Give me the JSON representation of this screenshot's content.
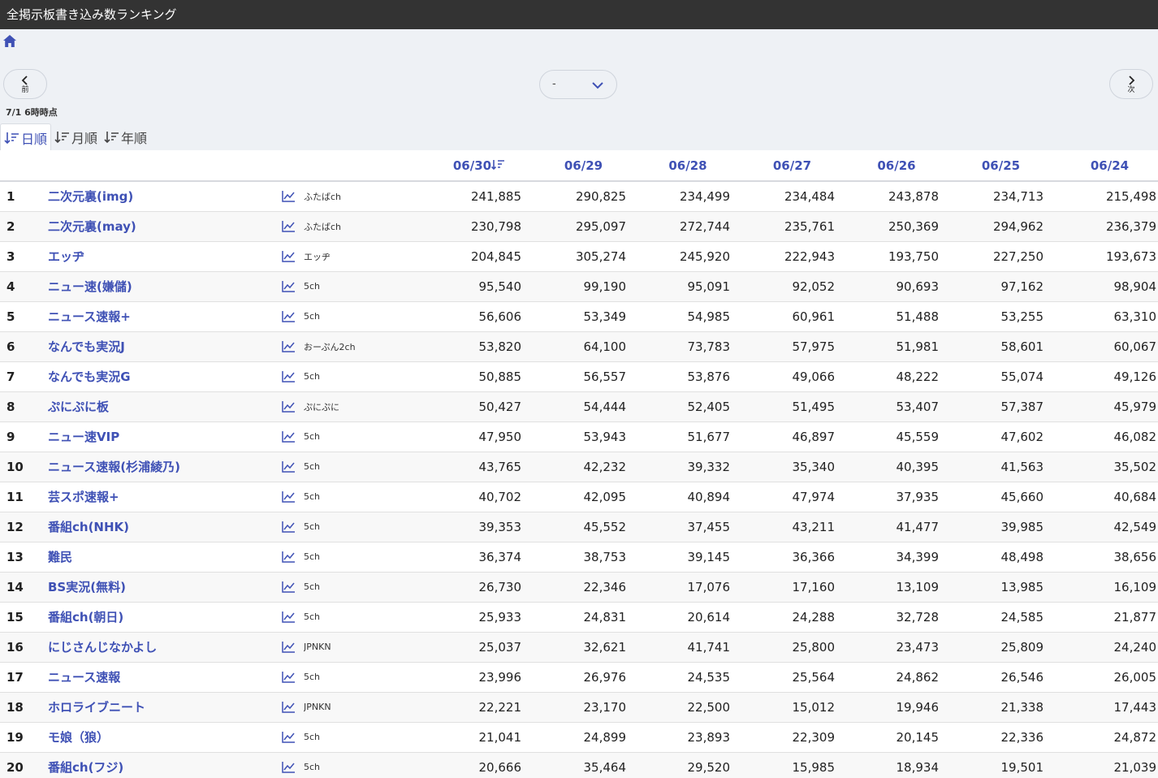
{
  "app": {
    "title": "全掲示板書き込み数ランキング"
  },
  "nav": {
    "prev_label": "前",
    "next_label": "次",
    "select_value": "-",
    "timestamp": "7/1 6時時点"
  },
  "tabs": [
    {
      "label": "日順",
      "active": true
    },
    {
      "label": "月順",
      "active": false
    },
    {
      "label": "年順",
      "active": false
    }
  ],
  "columns": [
    "06/30",
    "06/29",
    "06/28",
    "06/27",
    "06/26",
    "06/25",
    "06/24"
  ],
  "rows": [
    {
      "rank": "1",
      "name": "二次元裏(img)",
      "source": "ふたばch",
      "values": [
        "241,885",
        "290,825",
        "234,499",
        "234,484",
        "243,878",
        "234,713",
        "215,498"
      ]
    },
    {
      "rank": "2",
      "name": "二次元裏(may)",
      "source": "ふたばch",
      "values": [
        "230,798",
        "295,097",
        "272,744",
        "235,761",
        "250,369",
        "294,962",
        "236,379"
      ]
    },
    {
      "rank": "3",
      "name": "エッヂ",
      "source": "エッヂ",
      "values": [
        "204,845",
        "305,274",
        "245,920",
        "222,943",
        "193,750",
        "227,250",
        "193,673"
      ]
    },
    {
      "rank": "4",
      "name": "ニュー速(嫌儲)",
      "source": "5ch",
      "values": [
        "95,540",
        "99,190",
        "95,091",
        "92,052",
        "90,693",
        "97,162",
        "98,904"
      ]
    },
    {
      "rank": "5",
      "name": "ニュース速報+",
      "source": "5ch",
      "values": [
        "56,606",
        "53,349",
        "54,985",
        "60,961",
        "51,488",
        "53,255",
        "63,310"
      ]
    },
    {
      "rank": "6",
      "name": "なんでも実況J",
      "source": "おーぷん2ch",
      "values": [
        "53,820",
        "64,100",
        "73,783",
        "57,975",
        "51,981",
        "58,601",
        "60,067"
      ]
    },
    {
      "rank": "7",
      "name": "なんでも実況G",
      "source": "5ch",
      "values": [
        "50,885",
        "56,557",
        "53,876",
        "49,066",
        "48,222",
        "55,074",
        "49,126"
      ]
    },
    {
      "rank": "8",
      "name": "ぷにぷに板",
      "source": "ぷにぷに",
      "values": [
        "50,427",
        "54,444",
        "52,405",
        "51,495",
        "53,407",
        "57,387",
        "45,979"
      ]
    },
    {
      "rank": "9",
      "name": "ニュー速VIP",
      "source": "5ch",
      "values": [
        "47,950",
        "53,943",
        "51,677",
        "46,897",
        "45,559",
        "47,602",
        "46,082"
      ]
    },
    {
      "rank": "10",
      "name": "ニュース速報(杉浦綾乃)",
      "source": "5ch",
      "values": [
        "43,765",
        "42,232",
        "39,332",
        "35,340",
        "40,395",
        "41,563",
        "35,502"
      ]
    },
    {
      "rank": "11",
      "name": "芸スポ速報+",
      "source": "5ch",
      "values": [
        "40,702",
        "42,095",
        "40,894",
        "47,974",
        "37,935",
        "45,660",
        "40,684"
      ]
    },
    {
      "rank": "12",
      "name": "番組ch(NHK)",
      "source": "5ch",
      "values": [
        "39,353",
        "45,552",
        "37,455",
        "43,211",
        "41,477",
        "39,985",
        "42,549"
      ]
    },
    {
      "rank": "13",
      "name": "難民",
      "source": "5ch",
      "values": [
        "36,374",
        "38,753",
        "39,145",
        "36,366",
        "34,399",
        "48,498",
        "38,656"
      ]
    },
    {
      "rank": "14",
      "name": "BS実況(無料)",
      "source": "5ch",
      "values": [
        "26,730",
        "22,346",
        "17,076",
        "17,160",
        "13,109",
        "13,985",
        "16,109"
      ]
    },
    {
      "rank": "15",
      "name": "番組ch(朝日)",
      "source": "5ch",
      "values": [
        "25,933",
        "24,831",
        "20,614",
        "24,288",
        "32,728",
        "24,585",
        "21,877"
      ]
    },
    {
      "rank": "16",
      "name": "にじさんじなかよし",
      "source": "JPNKN",
      "values": [
        "25,037",
        "32,621",
        "41,741",
        "25,800",
        "23,473",
        "25,809",
        "24,240"
      ]
    },
    {
      "rank": "17",
      "name": "ニュース速報",
      "source": "5ch",
      "values": [
        "23,996",
        "26,976",
        "24,535",
        "25,564",
        "24,862",
        "26,546",
        "26,005"
      ]
    },
    {
      "rank": "18",
      "name": "ホロライブニート",
      "source": "JPNKN",
      "values": [
        "22,221",
        "23,170",
        "22,500",
        "15,012",
        "19,946",
        "21,338",
        "17,443"
      ]
    },
    {
      "rank": "19",
      "name": "モ娘（狼）",
      "source": "5ch",
      "values": [
        "21,041",
        "24,899",
        "23,893",
        "22,309",
        "20,145",
        "22,336",
        "24,872"
      ]
    },
    {
      "rank": "20",
      "name": "番組ch(フジ)",
      "source": "5ch",
      "values": [
        "20,666",
        "35,464",
        "29,520",
        "15,985",
        "18,934",
        "19,501",
        "21,039"
      ]
    }
  ],
  "colors": {
    "accent": "#3f51b5",
    "titlebar": "#333333"
  }
}
